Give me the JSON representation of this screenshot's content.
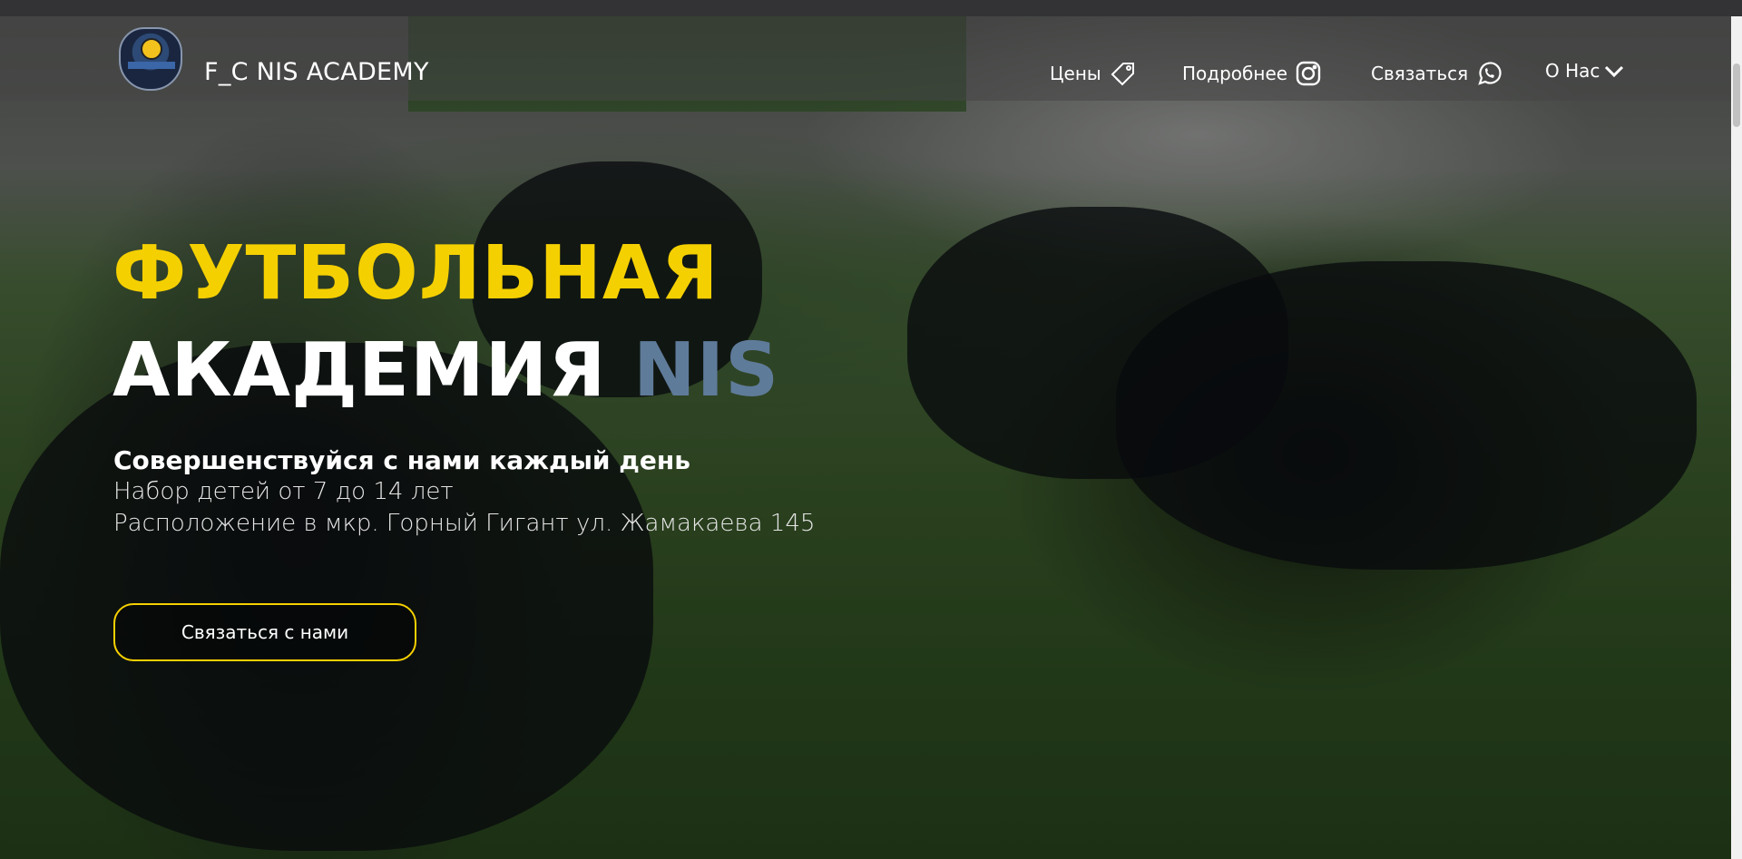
{
  "header": {
    "logo_text": "F_C NIS ACADEMY",
    "nav": [
      {
        "label": "Цены",
        "icon": "price-tag-icon"
      },
      {
        "label": "Подробнее",
        "icon": "instagram-icon"
      },
      {
        "label": "Связаться",
        "icon": "whatsapp-icon"
      },
      {
        "label": "О Нас",
        "icon": "chevron-down-icon"
      }
    ]
  },
  "hero": {
    "title_line1": "ФУТБОЛЬНАЯ",
    "title_line2_main": "АКАДЕМИЯ",
    "title_line2_accent": "NIS",
    "subtitle": "Совершенствуйся с нами каждый день",
    "info_line1": "Набор детей от 7 до 14 лет",
    "info_line2": "Расположение в мкр. Горный Гигант ул. Жамакаева 145",
    "cta_label": "Связаться с нами"
  },
  "colors": {
    "accent_yellow": "#f5d000",
    "accent_blue": "#5f7b9a",
    "text_white": "#ffffff"
  }
}
